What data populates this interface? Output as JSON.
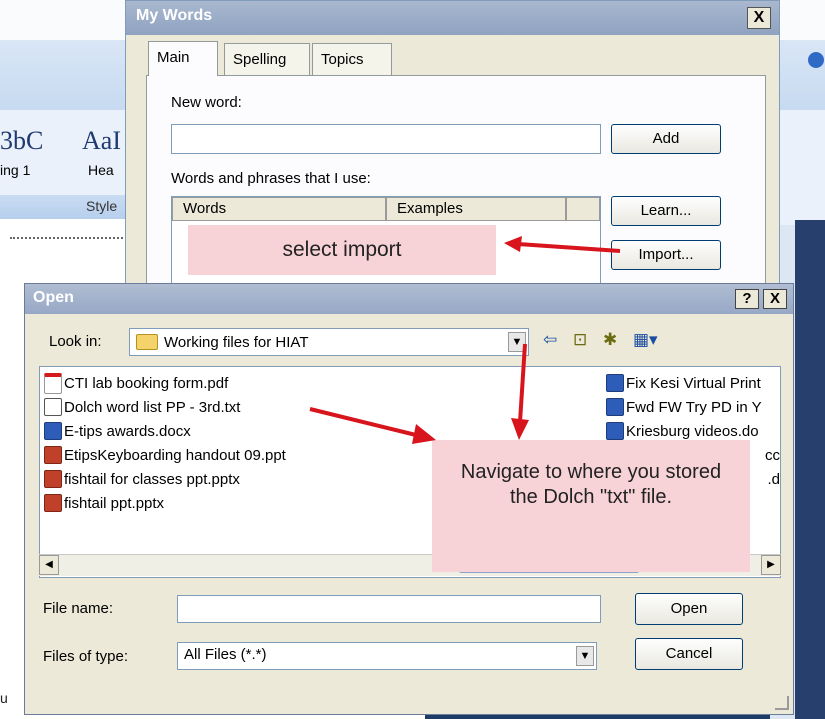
{
  "background_word": {
    "style_samples": [
      "AaBbCc",
      "AaBb"
    ],
    "style_sample_1": "3bC",
    "style_sample_2": "AaI",
    "style_name_1": "ing 1",
    "style_name_2": "Hea",
    "styles_group_label": "Style",
    "doc_text": "u"
  },
  "my_words": {
    "title": "My Words",
    "close_label": "X",
    "tabs": [
      {
        "label": "Main",
        "active": true
      },
      {
        "label": "Spelling",
        "active": false
      },
      {
        "label": "Topics",
        "active": false
      }
    ],
    "new_word_label": "New word:",
    "new_word_value": "",
    "add_button": "Add",
    "words_phrases_label": "Words and phrases that I use:",
    "columns": [
      "Words",
      "Examples"
    ],
    "learn_button": "Learn...",
    "import_button": "Import..."
  },
  "callouts": {
    "select_import": "select import",
    "navigate": "Navigate to where you stored the Dolch \"txt\" file."
  },
  "open_dialog": {
    "title": "Open",
    "help_label": "?",
    "close_label": "X",
    "look_in_label": "Look in:",
    "look_in_value": "Working files for HIAT",
    "files_left": [
      {
        "name": "CTI lab booking form.pdf",
        "icon": "pdf-icon"
      },
      {
        "name": "Dolch word list PP - 3rd.txt",
        "icon": "txt-icon"
      },
      {
        "name": "E-tips awards.docx",
        "icon": "doc-icon"
      },
      {
        "name": "EtipsKeyboarding handout 09.ppt",
        "icon": "ppt-icon"
      },
      {
        "name": "fishtail for classes ppt.pptx",
        "icon": "ppt-icon"
      },
      {
        "name": "fishtail ppt.pptx",
        "icon": "ppt-icon"
      }
    ],
    "files_right": [
      {
        "name": "Fix Kesi Virtual Print",
        "icon": "doc-icon"
      },
      {
        "name": "Fwd FW Try PD in Y",
        "icon": "doc-icon"
      },
      {
        "name": "Kriesburg videos.do",
        "icon": "doc-icon"
      },
      {
        "name": "cc",
        "icon": "doc-icon"
      },
      {
        "name": ".d",
        "icon": "doc-icon"
      }
    ],
    "file_name_label": "File name:",
    "file_name_value": "",
    "files_of_type_label": "Files of type:",
    "files_of_type_value": "All Files (*.*)",
    "open_button": "Open",
    "cancel_button": "Cancel"
  }
}
